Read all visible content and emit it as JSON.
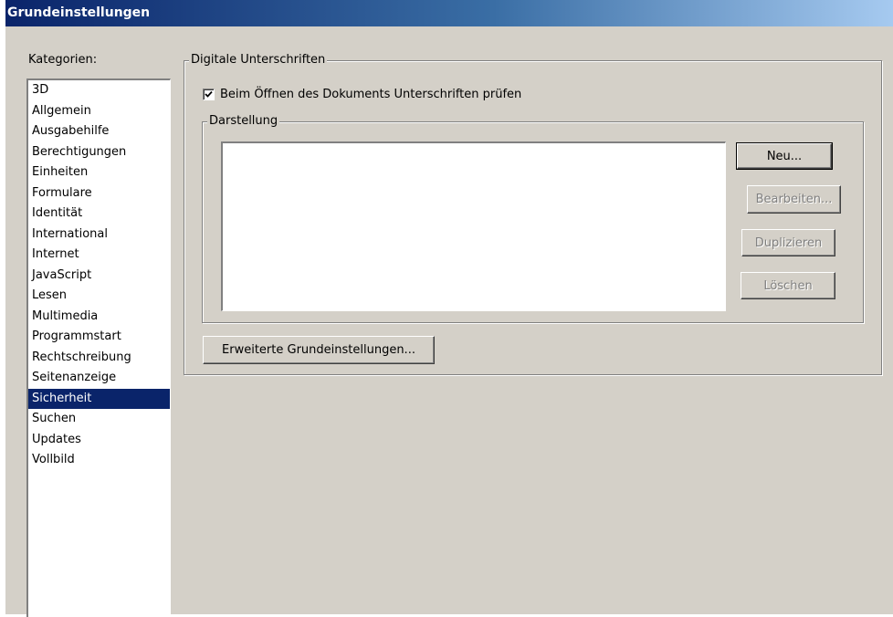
{
  "window": {
    "title": "Grundeinstellungen"
  },
  "categories": {
    "label": "Kategorien:",
    "items": [
      {
        "label": "3D"
      },
      {
        "label": "Allgemein"
      },
      {
        "label": "Ausgabehilfe"
      },
      {
        "label": "Berechtigungen"
      },
      {
        "label": "Einheiten"
      },
      {
        "label": "Formulare"
      },
      {
        "label": "Identität"
      },
      {
        "label": "International"
      },
      {
        "label": "Internet"
      },
      {
        "label": "JavaScript"
      },
      {
        "label": "Lesen"
      },
      {
        "label": "Multimedia"
      },
      {
        "label": "Programmstart"
      },
      {
        "label": "Rechtschreibung"
      },
      {
        "label": "Seitenanzeige"
      },
      {
        "label": "Sicherheit"
      },
      {
        "label": "Suchen"
      },
      {
        "label": "Updates"
      },
      {
        "label": "Vollbild"
      }
    ],
    "selected": "Sicherheit"
  },
  "signatures": {
    "group_title": "Digitale Unterschriften",
    "verify_checkbox": {
      "label": "Beim Öffnen des Dokuments Unterschriften prüfen",
      "checked": true
    },
    "appearance": {
      "group_title": "Darstellung",
      "buttons": {
        "new": "Neu...",
        "edit": "Bearbeiten...",
        "duplicate": "Duplizieren",
        "delete": "Löschen"
      }
    },
    "advanced_button": "Erweiterte Grundeinstellungen..."
  },
  "colors": {
    "face": "#d4d0c8",
    "selection": "#0a246a",
    "title_gradient_start": "#0a246a",
    "title_gradient_end": "#a6caf0",
    "disabled_text": "#808080"
  }
}
